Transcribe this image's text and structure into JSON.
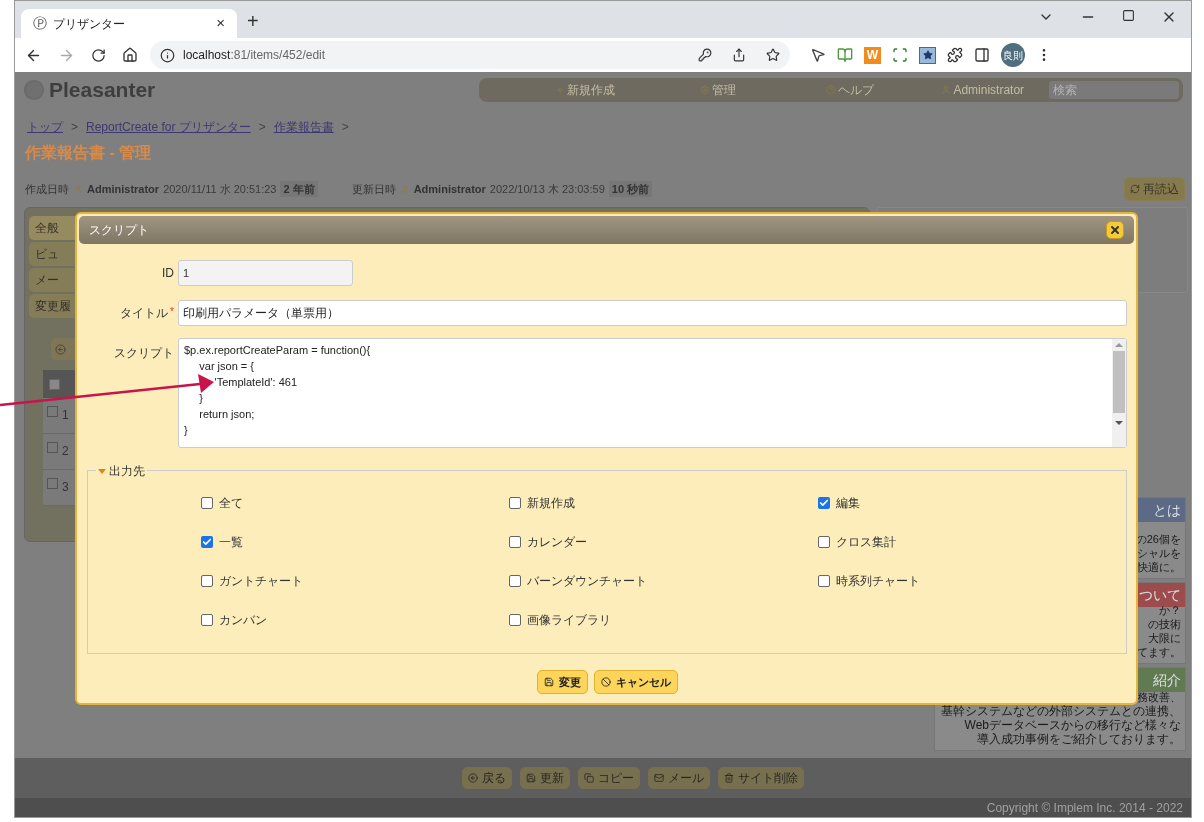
{
  "browser": {
    "tab": {
      "icon": "Ⓟ",
      "title": "プリザンター",
      "close": "×",
      "new_tab": "+"
    },
    "url": {
      "host": "localhost",
      "path": ":81/items/452/edit"
    },
    "extensions": [
      {
        "kind": "cursor"
      },
      {
        "kind": "book"
      },
      {
        "kind": "letter",
        "label": "W"
      },
      {
        "kind": "capture"
      },
      {
        "kind": "starbox"
      }
    ],
    "profile": "良則"
  },
  "page": {
    "logo": "Pleasanter",
    "nav": [
      {
        "kind": "plus",
        "label": "新規作成"
      },
      {
        "kind": "gear",
        "label": "管理"
      },
      {
        "kind": "help",
        "label": "ヘルプ"
      },
      {
        "kind": "user",
        "label": "Administrator"
      }
    ],
    "search": {
      "placeholder": "検索"
    },
    "breadcrumb": [
      "トップ",
      "ReportCreate for プリザンター",
      "作業報告書"
    ],
    "breadcrumb_sep": ">",
    "title": "作業報告書 - 管理",
    "created": {
      "label": "作成日時",
      "user": "Administrator",
      "time": "2020/11/11 水 20:51:23",
      "ago": "2 年前"
    },
    "updated": {
      "label": "更新日時",
      "user": "Administrator",
      "time": "2022/10/13 木 23:03:59",
      "ago": "10 秒前"
    },
    "reload": "再読込",
    "side_tabs": [
      {
        "label": "全般",
        "selected": true
      },
      {
        "label": "ビュ",
        "selected": false
      },
      {
        "label": "メー",
        "selected": false
      },
      {
        "label": "変更履",
        "selected": false
      }
    ],
    "header_checked": false,
    "rows": [
      {
        "number": "1",
        "checked": false
      },
      {
        "number": "2",
        "checked": false
      },
      {
        "number": "3",
        "checked": false
      }
    ],
    "ads": [
      {
        "color": "#5d6a85",
        "header": "とは",
        "lines": [
          "の26個を",
          "シャルを",
          "快適に。"
        ]
      },
      {
        "color": "#9c4c4c",
        "header": "ついて",
        "lines": [
          "か？",
          "の技術",
          "大限に",
          "てます。"
        ]
      },
      {
        "color": "#617a52",
        "header": "紹介",
        "lines": [
          "務改善、",
          "基幹システムなどの外部システムとの連携、",
          "Webデータベースからの移行など様々な",
          "導入成功事例をご紹介しております。"
        ]
      }
    ],
    "footer_buttons": [
      {
        "kind": "back",
        "label": "戻る"
      },
      {
        "kind": "save",
        "label": "更新"
      },
      {
        "kind": "copy",
        "label": "コピー"
      },
      {
        "kind": "mail",
        "label": "メール"
      },
      {
        "kind": "trash",
        "label": "サイト削除"
      }
    ],
    "copyright": "Copyright © Implem Inc. 2014 - 2022"
  },
  "dialog": {
    "title": "スクリプト",
    "id": {
      "label": "ID",
      "value": "1"
    },
    "title_field": {
      "label": "タイトル",
      "required_mark": "*",
      "value": "印刷用パラメータ（単票用）"
    },
    "script": {
      "label": "スクリプト",
      "value": "$p.ex.reportCreateParam = function(){\n     var json = {\n          'TemplateId': 461\n     }\n     return json;\n}"
    },
    "output": {
      "legend": "出力先",
      "expanded": true,
      "options": [
        {
          "label": "全て",
          "checked": false
        },
        {
          "label": "新規作成",
          "checked": false
        },
        {
          "label": "編集",
          "checked": true
        },
        {
          "label": "一覧",
          "checked": true
        },
        {
          "label": "カレンダー",
          "checked": false
        },
        {
          "label": "クロス集計",
          "checked": false
        },
        {
          "label": "ガントチャート",
          "checked": false
        },
        {
          "label": "バーンダウンチャート",
          "checked": false
        },
        {
          "label": "時系列チャート",
          "checked": false
        },
        {
          "label": "カンバン",
          "checked": false
        },
        {
          "label": "画像ライブラリ",
          "checked": false
        }
      ]
    },
    "buttons": [
      {
        "kind": "save",
        "label": "変更"
      },
      {
        "kind": "cancel",
        "label": "キャンセル"
      }
    ]
  }
}
